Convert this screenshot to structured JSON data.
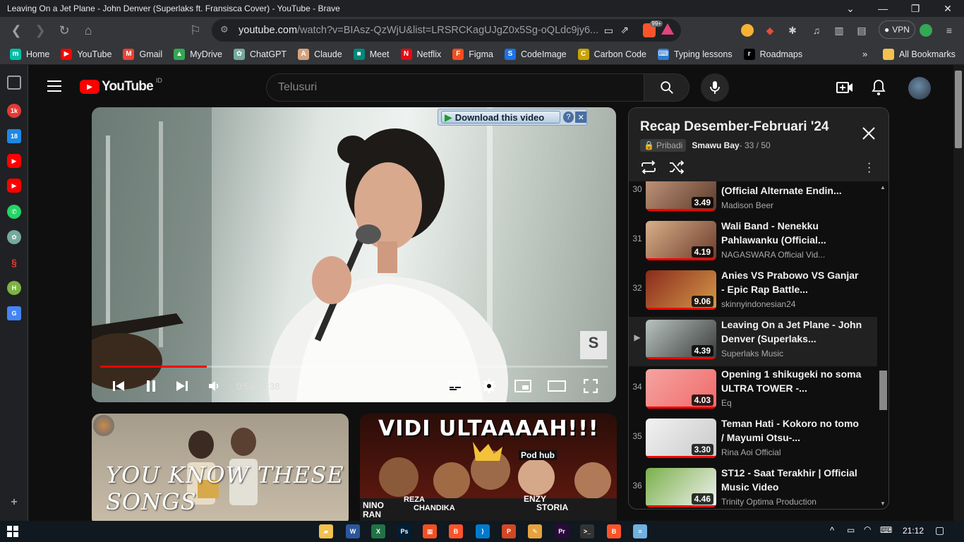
{
  "window": {
    "title": "Leaving On a Jet Plane - John Denver (Superlaks ft. Fransisca Cover) - YouTube - Brave"
  },
  "toolbar": {
    "url_host": "youtube.com",
    "url_path": "/watch?v=BIAsz-QzWjU&list=LRSRCKagUJgZ0x5Sg-oQLdc9jy6...",
    "shields_badge": "99+",
    "vpn_label": "VPN"
  },
  "bookmarks": {
    "items": [
      {
        "label": "Home",
        "color": "#00bfa5",
        "glyph": "m"
      },
      {
        "label": "YouTube",
        "color": "#ff0000",
        "glyph": "▶"
      },
      {
        "label": "Gmail",
        "color": "#ea4335",
        "glyph": "M"
      },
      {
        "label": "MyDrive",
        "color": "#34a853",
        "glyph": "▲"
      },
      {
        "label": "ChatGPT",
        "color": "#74aa9c",
        "glyph": "✿"
      },
      {
        "label": "Claude",
        "color": "#d4a27f",
        "glyph": "A"
      },
      {
        "label": "Meet",
        "color": "#00897b",
        "glyph": "■"
      },
      {
        "label": "Netflix",
        "color": "#e50914",
        "glyph": "N"
      },
      {
        "label": "Figma",
        "color": "#f24e1e",
        "glyph": "F"
      },
      {
        "label": "CodeImage",
        "color": "#1a73e8",
        "glyph": "S"
      },
      {
        "label": "Carbon Code",
        "color": "#c8a400",
        "glyph": "C"
      },
      {
        "label": "Typing lessons",
        "color": "#2e7dd1",
        "glyph": "⌨"
      },
      {
        "label": "Roadmaps",
        "color": "#000000",
        "glyph": "r"
      }
    ],
    "all_bookmarks": "All Bookmarks"
  },
  "youtube": {
    "logo": "YouTube",
    "region": "ID",
    "search_placeholder": "Telusuri"
  },
  "player": {
    "download_label": "Download this video",
    "time": "0:58 / 4:38",
    "progress": 0.21,
    "watermark": "S"
  },
  "recommendations": [
    {
      "overlay": "YOU KNOW THESE SONGS"
    },
    {
      "overlay": "VIDI ULTAAAAH!!!",
      "labels": [
        "NINO RAN",
        "REZA",
        "CHANDIKA",
        "ENZY",
        "STORIA",
        "Pod hub"
      ]
    }
  ],
  "playlist": {
    "title": "Recap Desember-Februari '24",
    "privacy": "Pribadi",
    "owner": "Smawu Bay",
    "position": " - 33 / 50",
    "items": [
      {
        "index": "30",
        "title": "Madison Beer - Reckless (Official Alternate Endin...",
        "channel": "Madison Beer",
        "duration": "3.49",
        "c1": "#c79a7e",
        "c2": "#5a3a2c"
      },
      {
        "index": "31",
        "title": "Wali Band - Nenekku Pahlawanku (Official...",
        "channel": "NAGASWARA Official Vid...",
        "duration": "4.19",
        "c1": "#d8b08a",
        "c2": "#6b3b2a"
      },
      {
        "index": "32",
        "title": "Anies VS Prabowo VS Ganjar - Epic Rap Battle...",
        "channel": "skinnyindonesian24",
        "duration": "9.06",
        "c1": "#8a2b1c",
        "c2": "#d69a4a"
      },
      {
        "index": "▶",
        "title": "Leaving On a Jet Plane - John Denver (Superlaks...",
        "channel": "Superlaks Music",
        "duration": "4.39",
        "c1": "#b8c3bf",
        "c2": "#3a3a3a"
      },
      {
        "index": "34",
        "title": "Opening 1 shikugeki no soma ULTRA TOWER -...",
        "channel": "Eq",
        "duration": "4.03",
        "c1": "#f4a4a0",
        "c2": "#f06a6a"
      },
      {
        "index": "35",
        "title": "Teman Hati - Kokoro no tomo / Mayumi Otsu-...",
        "channel": "Rina Aoi Official",
        "duration": "3.30",
        "c1": "#f2f2f2",
        "c2": "#c9c9c9"
      },
      {
        "index": "36",
        "title": "ST12 - Saat Terakhir | Official Music Video",
        "channel": "Trinity Optima Production",
        "duration": "4.46",
        "c1": "#7ab04a",
        "c2": "#f2f2f2"
      }
    ]
  },
  "taskbar": {
    "time": "21:12",
    "apps": [
      {
        "name": "file-explorer",
        "color": "#f2c14e",
        "glyph": "▰"
      },
      {
        "name": "word",
        "color": "#2b579a",
        "glyph": "W"
      },
      {
        "name": "excel",
        "color": "#217346",
        "glyph": "X"
      },
      {
        "name": "photoshop",
        "color": "#001e36",
        "glyph": "Ps"
      },
      {
        "name": "store",
        "color": "#f25022",
        "glyph": "▦"
      },
      {
        "name": "brave",
        "color": "#fb542b",
        "glyph": "B"
      },
      {
        "name": "vscode",
        "color": "#007acc",
        "glyph": "⟩"
      },
      {
        "name": "powerpoint",
        "color": "#d24726",
        "glyph": "P"
      },
      {
        "name": "paint",
        "color": "#e6a23c",
        "glyph": "✎"
      },
      {
        "name": "premiere",
        "color": "#2a0a3a",
        "glyph": "Pr"
      },
      {
        "name": "terminal",
        "color": "#333333",
        "glyph": ">_"
      },
      {
        "name": "brave-2",
        "color": "#fb542b",
        "glyph": "B"
      },
      {
        "name": "notepad",
        "color": "#6fb1e0",
        "glyph": "≡"
      }
    ]
  }
}
